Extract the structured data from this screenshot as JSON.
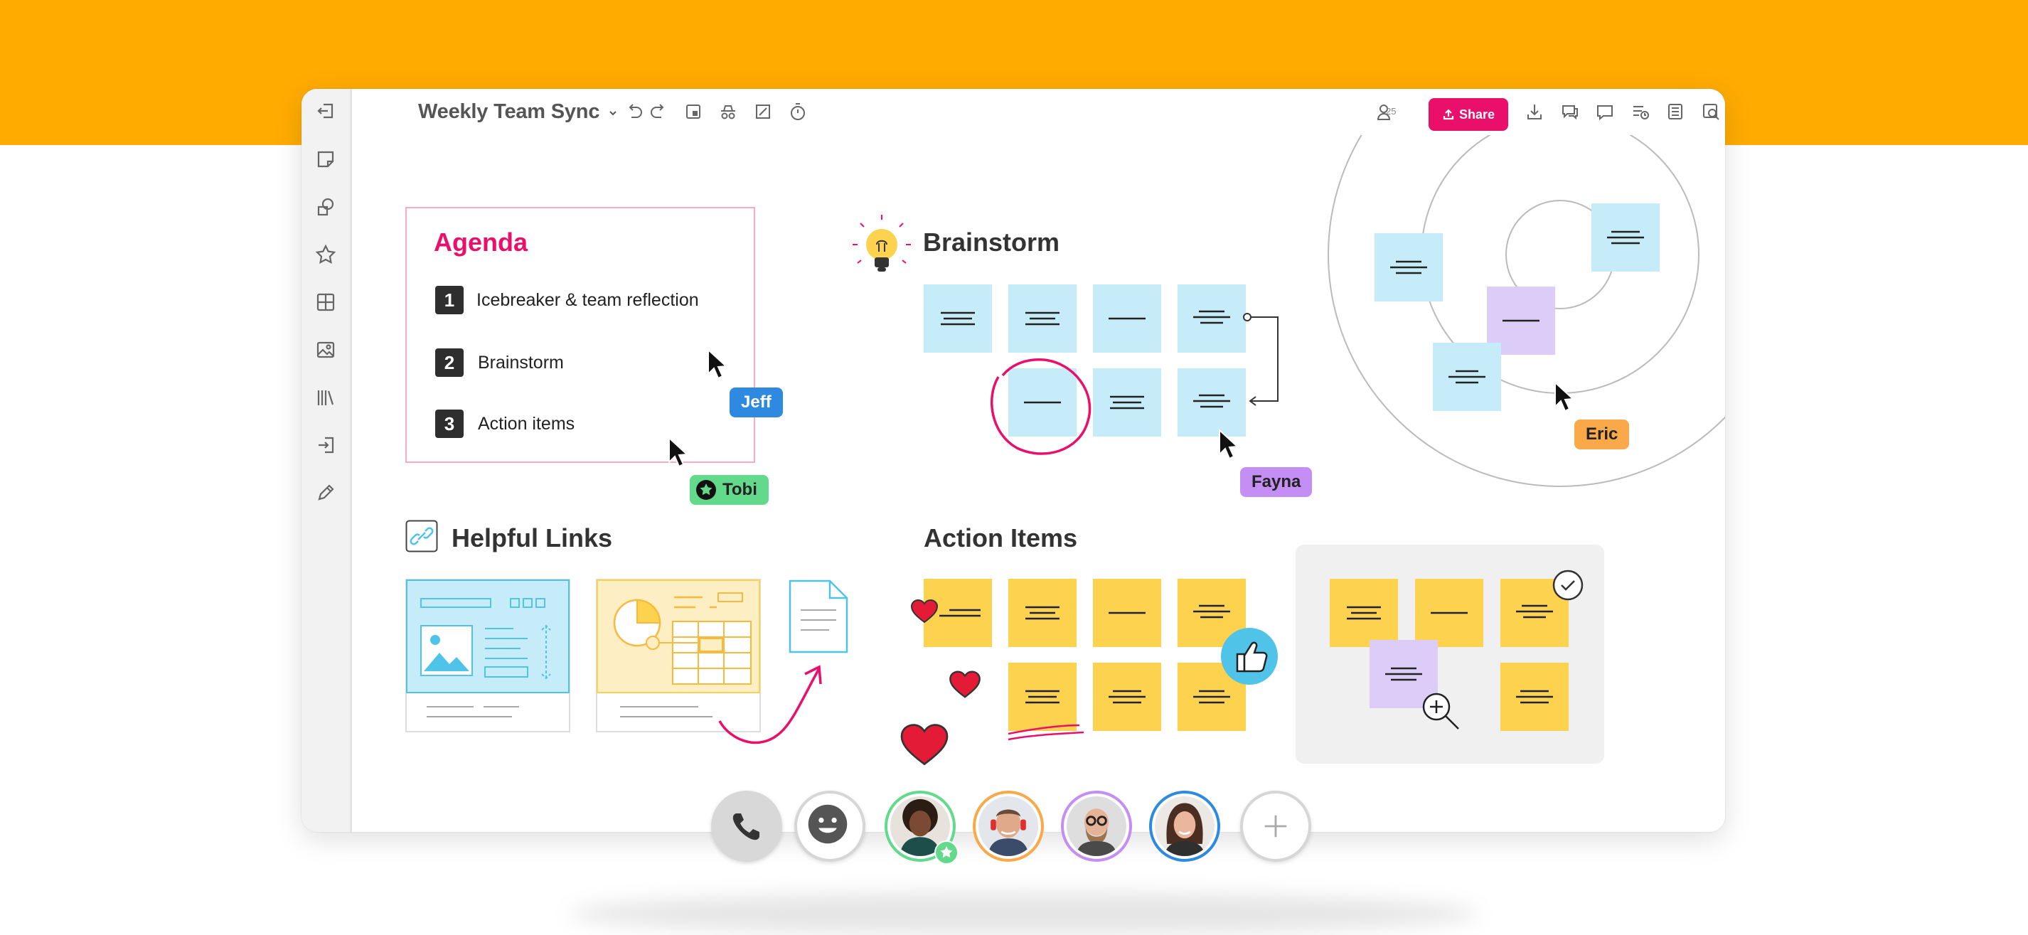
{
  "board": {
    "title": "Weekly Team Sync",
    "user_count": "25",
    "share_label": "Share"
  },
  "sidebar": {
    "items": [
      {
        "icon": "exit-board-icon"
      },
      {
        "icon": "sticky-note-icon"
      },
      {
        "icon": "shapes-icon"
      },
      {
        "icon": "star-icon"
      },
      {
        "icon": "table-icon"
      },
      {
        "icon": "image-icon"
      },
      {
        "icon": "library-icon"
      },
      {
        "icon": "import-icon"
      },
      {
        "icon": "pen-icon"
      }
    ]
  },
  "toolbar": {
    "left_tools": [
      "undo-icon",
      "redo-icon",
      "frame-icon",
      "visitor-icon",
      "select-icon",
      "timer-icon"
    ],
    "right_tools": [
      "download-icon",
      "comments-icon",
      "chat-icon",
      "activity-icon",
      "outline-icon",
      "search-icon",
      "help-icon"
    ]
  },
  "agenda": {
    "title": "Agenda",
    "items": [
      {
        "number": "1",
        "text": "Icebreaker & team reflection"
      },
      {
        "number": "2",
        "text": "Brainstorm"
      },
      {
        "number": "3",
        "text": "Action items"
      }
    ]
  },
  "sections": {
    "brainstorm": "Brainstorm",
    "helpful_links": "Helpful Links",
    "action_items": "Action Items"
  },
  "collaborators": [
    {
      "name": "Jeff",
      "color": "#2d8ae0"
    },
    {
      "name": "Tobi",
      "color": "#63d98b"
    },
    {
      "name": "Fayna",
      "color": "#c48ef4"
    },
    {
      "name": "Eric",
      "color": "#f9a94a"
    }
  ],
  "colors": {
    "banner": "#ffab00",
    "accent": "#ea0f6b",
    "sticky_blue": "#c6ecfa",
    "sticky_purple": "#dccdf8",
    "sticky_yellow": "#fdd24f"
  },
  "call_bar": {
    "buttons": [
      "phone-icon",
      "emoji-icon",
      "add-participant-icon"
    ],
    "participant_count": 4
  }
}
